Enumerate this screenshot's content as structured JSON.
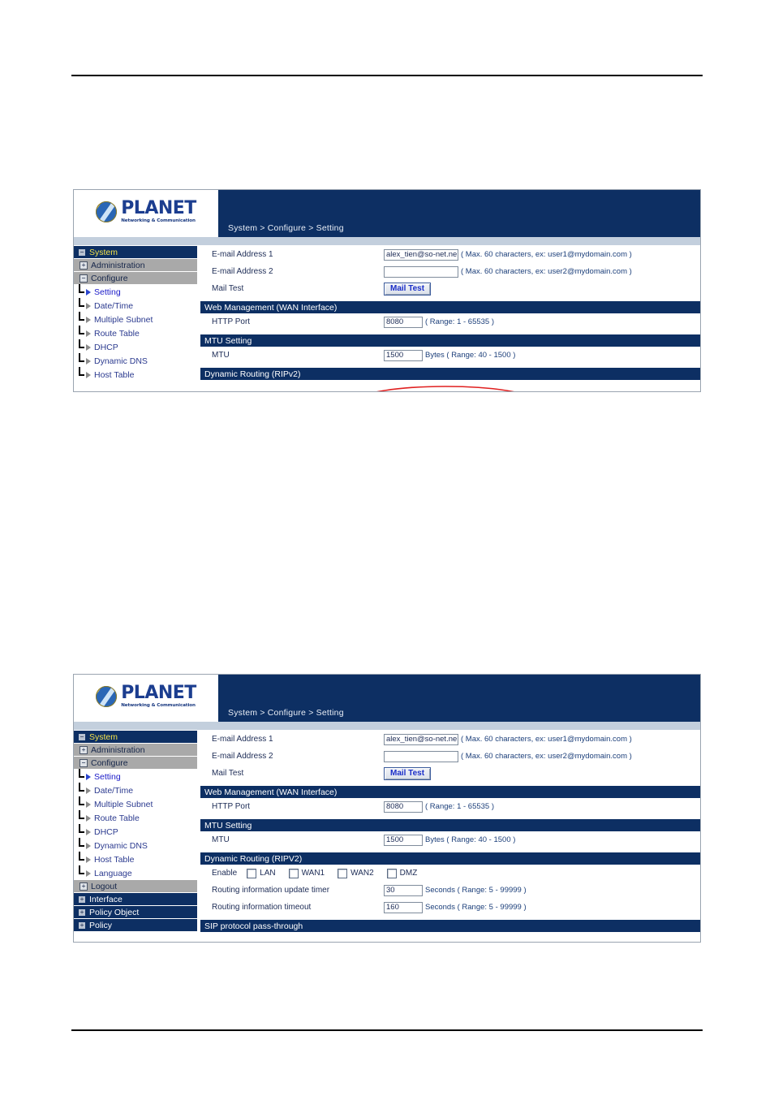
{
  "figures": [
    {
      "id": "figure-1",
      "banner": {
        "logo_word": "PLANET",
        "logo_tagline": "Networking & Communication",
        "breadcrumb": "System > Configure > Setting"
      },
      "sidebar": {
        "top_items": [
          {
            "label": "System",
            "icon": "minus-box-icon",
            "state": "expanded",
            "selected": true
          }
        ],
        "sub_items": [
          {
            "label": "Administration",
            "icon": "plus-box-icon",
            "state": "collapsed"
          },
          {
            "label": "Configure",
            "icon": "minus-box-icon",
            "state": "expanded"
          }
        ],
        "leaf_items": [
          {
            "label": "Setting",
            "active": true
          },
          {
            "label": "Date/Time",
            "active": false
          },
          {
            "label": "Multiple Subnet",
            "active": false
          },
          {
            "label": "Route Table",
            "active": false
          },
          {
            "label": "DHCP",
            "active": false
          },
          {
            "label": "Dynamic DNS",
            "active": false
          },
          {
            "label": "Host Table",
            "active": false
          }
        ]
      },
      "form": {
        "email1_label": "E-mail Address 1",
        "email1_value": "alex_tien@so-net.ne",
        "email1_hint": "( Max. 60 characters, ex: user1@mydomain.com )",
        "email2_label": "E-mail Address 2",
        "email2_value": "",
        "email2_hint": "( Max. 60 characters, ex: user2@mydomain.com )",
        "mailtest_label": "Mail Test",
        "mailtest_button": "Mail Test",
        "sec_web": "Web Management (WAN Interface)",
        "http_label": "HTTP Port",
        "http_value": "8080",
        "http_hint": "( Range: 1 - 65535 )",
        "sec_mtu": "MTU Setting",
        "mtu_label": "MTU",
        "mtu_value": "1500",
        "mtu_hint": "Bytes ( Range: 40 - 1500 )",
        "sec_rip": "Dynamic Routing (RIPv2)"
      },
      "annotation": {
        "type": "red-ellipse",
        "color": "#e02020",
        "targets": "MTU value field and Bytes range hint"
      }
    },
    {
      "id": "figure-2",
      "banner": {
        "logo_word": "PLANET",
        "logo_tagline": "Networking & Communication",
        "breadcrumb": "System > Configure > Setting"
      },
      "sidebar": {
        "top_items": [
          {
            "label": "System",
            "icon": "minus-box-icon",
            "state": "expanded",
            "selected": true
          }
        ],
        "sub_items": [
          {
            "label": "Administration",
            "icon": "plus-box-icon",
            "state": "collapsed"
          },
          {
            "label": "Configure",
            "icon": "minus-box-icon",
            "state": "expanded"
          }
        ],
        "leaf_items": [
          {
            "label": "Setting",
            "active": true
          },
          {
            "label": "Date/Time",
            "active": false
          },
          {
            "label": "Multiple Subnet",
            "active": false
          },
          {
            "label": "Route Table",
            "active": false
          },
          {
            "label": "DHCP",
            "active": false
          },
          {
            "label": "Dynamic DNS",
            "active": false
          },
          {
            "label": "Host Table",
            "active": false
          },
          {
            "label": "Language",
            "active": false
          }
        ],
        "logout": {
          "label": "Logout",
          "icon": "plus-box-icon"
        },
        "sections": [
          {
            "label": "Interface",
            "icon": "plus-box-icon"
          },
          {
            "label": "Policy Object",
            "icon": "plus-box-icon"
          },
          {
            "label": "Policy",
            "icon": "plus-box-icon"
          }
        ]
      },
      "form": {
        "email1_label": "E-mail Address 1",
        "email1_value": "alex_tien@so-net.ne",
        "email1_hint": "( Max. 60 characters, ex: user1@mydomain.com )",
        "email2_label": "E-mail Address 2",
        "email2_value": "",
        "email2_hint": "( Max. 60 characters, ex: user2@mydomain.com )",
        "mailtest_label": "Mail Test",
        "mailtest_button": "Mail Test",
        "sec_web": "Web Management (WAN Interface)",
        "http_label": "HTTP Port",
        "http_value": "8080",
        "http_hint": "( Range: 1 - 65535 )",
        "sec_mtu": "MTU Setting",
        "mtu_label": "MTU",
        "mtu_value": "1500",
        "mtu_hint": "Bytes ( Range: 40 - 1500 )",
        "sec_rip": "Dynamic Routing (RIPV2)",
        "enable_label": "Enable",
        "checkboxes": [
          {
            "label": "LAN",
            "checked": false
          },
          {
            "label": "WAN1",
            "checked": false
          },
          {
            "label": "WAN2",
            "checked": false
          },
          {
            "label": "DMZ",
            "checked": false
          }
        ],
        "update_timer_label": "Routing information update timer",
        "update_timer_value": "30",
        "update_timer_hint": "Seconds ( Range: 5 - 99999 )",
        "timeout_label": "Routing information timeout",
        "timeout_value": "160",
        "timeout_hint": "Seconds ( Range: 5 - 99999 )",
        "sec_sip": "SIP protocol pass-through"
      }
    }
  ],
  "colors": {
    "navy": "#0d2f63",
    "gray_nav": "#a9a9a9",
    "highlight_yellow": "#f2e14a",
    "annotation_red": "#e02020"
  }
}
